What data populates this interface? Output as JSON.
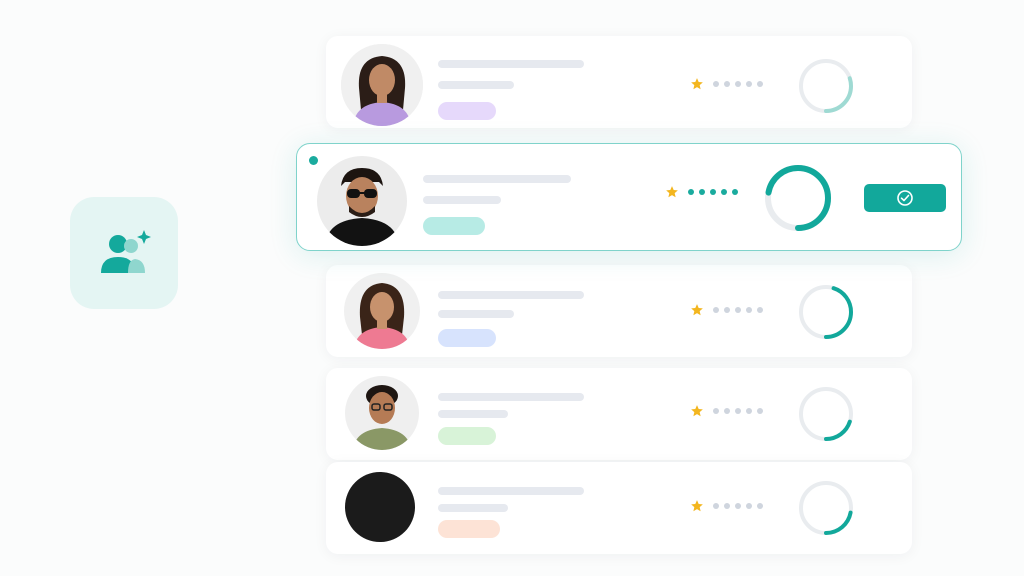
{
  "colors": {
    "accent": "#12a89b",
    "tile_bg": "#e4f5f3",
    "bar": "#e6e9ef",
    "star": "#f3b61f",
    "dot_off": "#cfd5de"
  },
  "app_icon": {
    "name": "team-users-sparkle-icon"
  },
  "candidates": [
    {
      "avatar": "avatar-woman-purple-top",
      "tag_color": "#e6d9fb",
      "rating_filled": 0,
      "progress": 0.3,
      "ring_color": "#9fdad3"
    },
    {
      "avatar": "avatar-man-sunglasses",
      "tag_color": "#b7ebe5",
      "rating_filled": 5,
      "progress": 0.72,
      "ring_color": "#12a89b",
      "selected": true,
      "action_icon": "check-circle-icon"
    },
    {
      "avatar": "avatar-woman-pink-top",
      "tag_color": "#d7e3fd",
      "rating_filled": 0,
      "progress": 0.45,
      "ring_color": "#12a89b"
    },
    {
      "avatar": "avatar-man-glasses-green-shirt",
      "tag_color": "#d8f3d8",
      "rating_filled": 0,
      "progress": 0.2,
      "ring_color": "#12a89b"
    },
    {
      "avatar": "avatar-dark-placeholder",
      "tag_color": "#fde3d6",
      "rating_filled": 0,
      "progress": 0.22,
      "ring_color": "#12a89b"
    }
  ]
}
